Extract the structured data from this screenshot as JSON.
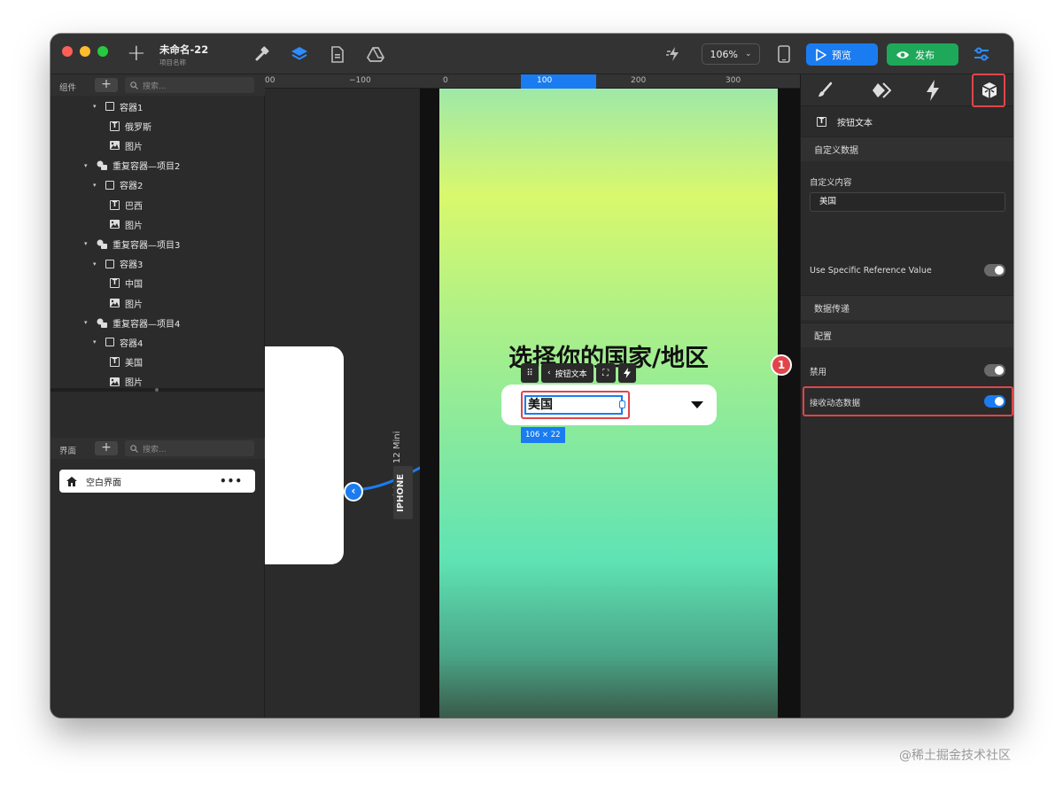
{
  "window": {
    "title": "未命名-22",
    "subtitle": "项目名称",
    "zoom": "106%",
    "preview_label": "预览",
    "publish_label": "发布"
  },
  "ruler": {
    "ticks": [
      "00",
      "−100",
      "0",
      "100",
      "200",
      "300"
    ]
  },
  "components_panel": {
    "title": "组件",
    "search_placeholder": "搜索...",
    "tree": [
      {
        "type": "container",
        "label": "容器1",
        "expanded": true
      },
      {
        "type": "text",
        "label": "俄罗斯"
      },
      {
        "type": "image",
        "label": "图片"
      },
      {
        "type": "repeat",
        "label": "重复容器—项目2",
        "expanded": true
      },
      {
        "type": "container",
        "label": "容器2",
        "expanded": true
      },
      {
        "type": "text",
        "label": "巴西"
      },
      {
        "type": "image",
        "label": "图片"
      },
      {
        "type": "repeat",
        "label": "重复容器—项目3",
        "expanded": true
      },
      {
        "type": "container",
        "label": "容器3",
        "expanded": true
      },
      {
        "type": "text",
        "label": "中国"
      },
      {
        "type": "image",
        "label": "图片"
      },
      {
        "type": "repeat",
        "label": "重复容器—项目4",
        "expanded": true
      },
      {
        "type": "container",
        "label": "容器4",
        "expanded": true
      },
      {
        "type": "text",
        "label": "美国"
      },
      {
        "type": "image",
        "label": "图片"
      }
    ]
  },
  "screens_panel": {
    "title": "界面",
    "search_placeholder": "搜索...",
    "screens": [
      {
        "label": "空白界面"
      }
    ]
  },
  "canvas": {
    "device_name": "iPhone 12 Mini",
    "device_tag": "IPHONE",
    "heading": "选择你的国家/地区",
    "selected_label": "按钮文本",
    "dropdown_value": "美国",
    "size_badge": "106 × 22",
    "colors": {
      "gradient_top": "#9fe8a8",
      "gradient_mid": "#d9f86d",
      "gradient_low": "#5fe3b4",
      "gradient_bottom": "#3a5a4a",
      "accent": "#1a7cf0"
    }
  },
  "inspector": {
    "element_name": "按钮文本",
    "custom_data_section": "自定义数据",
    "custom_content_label": "自定义内容",
    "custom_content_value": "美国",
    "use_ref_label": "Use Specific Reference Value",
    "use_ref_on": false,
    "data_transfer_section": "数据传递",
    "config_section": "配置",
    "disable_label": "禁用",
    "disable_on": false,
    "dynamic_label": "接收动态数据",
    "dynamic_on": true,
    "callout_number": "1",
    "colors": {
      "accent": "#1a7cf0",
      "highlight": "#e0454a"
    }
  },
  "watermark": "@稀土掘金技术社区"
}
